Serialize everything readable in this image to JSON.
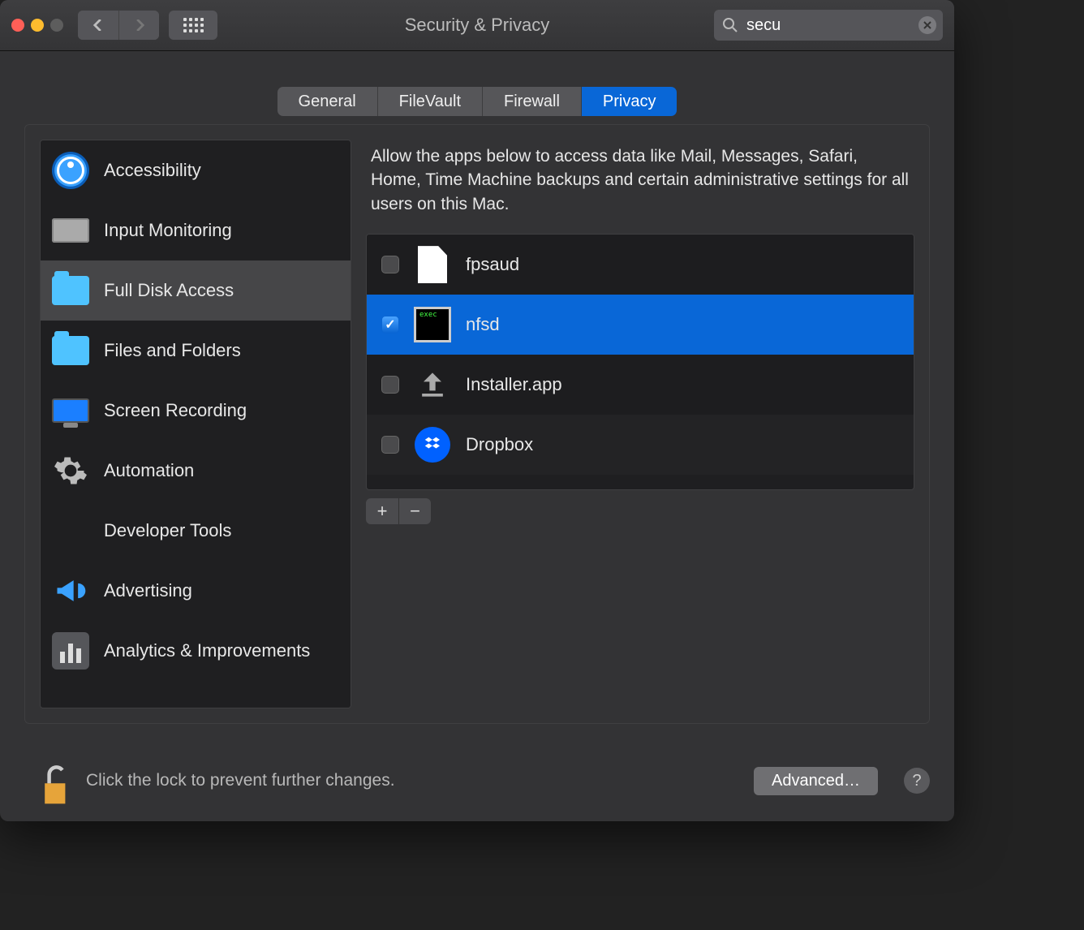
{
  "window": {
    "title": "Security & Privacy"
  },
  "search": {
    "value": "secu"
  },
  "tabs": [
    {
      "label": "General",
      "active": false
    },
    {
      "label": "FileVault",
      "active": false
    },
    {
      "label": "Firewall",
      "active": false
    },
    {
      "label": "Privacy",
      "active": true
    }
  ],
  "sidebar": {
    "items": [
      {
        "label": "Accessibility",
        "icon": "accessibility-icon",
        "selected": false
      },
      {
        "label": "Input Monitoring",
        "icon": "keyboard-icon",
        "selected": false
      },
      {
        "label": "Full Disk Access",
        "icon": "folder-icon",
        "selected": true
      },
      {
        "label": "Files and Folders",
        "icon": "folder-icon",
        "selected": false
      },
      {
        "label": "Screen Recording",
        "icon": "screen-icon",
        "selected": false
      },
      {
        "label": "Automation",
        "icon": "gear-icon",
        "selected": false
      },
      {
        "label": "Developer Tools",
        "icon": "",
        "selected": false
      },
      {
        "label": "Advertising",
        "icon": "megaphone-icon",
        "selected": false
      },
      {
        "label": "Analytics & Improvements",
        "icon": "chart-icon",
        "selected": false
      }
    ]
  },
  "main": {
    "description": "Allow the apps below to access data like Mail, Messages, Safari, Home, Time Machine backups and certain administrative settings for all users on this Mac.",
    "apps": [
      {
        "name": "fpsaud",
        "checked": false,
        "selected": false,
        "icon": "document-icon"
      },
      {
        "name": "nfsd",
        "checked": true,
        "selected": true,
        "icon": "terminal-icon"
      },
      {
        "name": "Installer.app",
        "checked": false,
        "selected": false,
        "icon": "installer-icon"
      },
      {
        "name": "Dropbox",
        "checked": false,
        "selected": false,
        "icon": "dropbox-icon"
      }
    ]
  },
  "footer": {
    "lock_text": "Click the lock to prevent further changes.",
    "advanced_label": "Advanced…"
  }
}
